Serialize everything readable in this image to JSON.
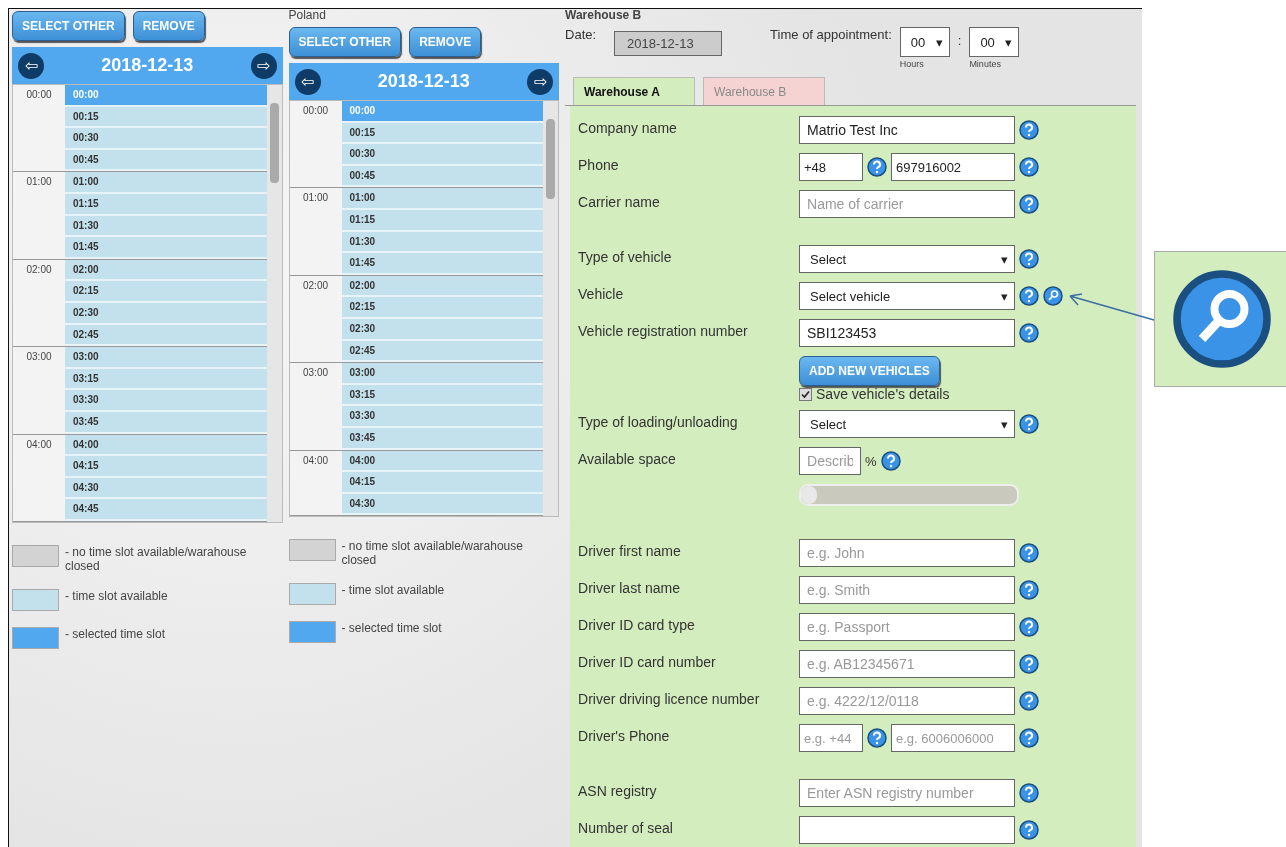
{
  "calendars": [
    {
      "buttons": [
        "SELECT OTHER",
        "REMOVE"
      ],
      "date": "2018-12-13",
      "prev": "⇦",
      "next": "⇨",
      "hours": [
        {
          "label": "00:00",
          "slots": [
            {
              "time": "00:00",
              "selected": true
            },
            {
              "time": "00:15",
              "selected": false
            },
            {
              "time": "00:30",
              "selected": false
            },
            {
              "time": "00:45",
              "selected": false
            }
          ]
        },
        {
          "label": "01:00",
          "slots": [
            {
              "time": "01:00",
              "selected": false
            },
            {
              "time": "01:15",
              "selected": false
            },
            {
              "time": "01:30",
              "selected": false
            },
            {
              "time": "01:45",
              "selected": false
            }
          ]
        },
        {
          "label": "02:00",
          "slots": [
            {
              "time": "02:00",
              "selected": false
            },
            {
              "time": "02:15",
              "selected": false
            },
            {
              "time": "02:30",
              "selected": false
            },
            {
              "time": "02:45",
              "selected": false
            }
          ]
        },
        {
          "label": "03:00",
          "slots": [
            {
              "time": "03:00",
              "selected": false
            },
            {
              "time": "03:15",
              "selected": false
            },
            {
              "time": "03:30",
              "selected": false
            },
            {
              "time": "03:45",
              "selected": false
            }
          ]
        },
        {
          "label": "04:00",
          "slots": [
            {
              "time": "04:00",
              "selected": false
            },
            {
              "time": "04:15",
              "selected": false
            },
            {
              "time": "04:30",
              "selected": false
            },
            {
              "time": "04:45",
              "selected": false
            }
          ]
        }
      ],
      "legend": [
        {
          "color": "#d3d3d3",
          "text": "- no time slot available/warahouse closed"
        },
        {
          "color": "#c3e1ec",
          "text": "- time slot available"
        },
        {
          "color": "#52a8ee",
          "text": "- selected time slot"
        }
      ]
    },
    {
      "caption": "Poland",
      "buttons": [
        "SELECT OTHER",
        "REMOVE"
      ],
      "date": "2018-12-13",
      "prev": "⇦",
      "next": "⇨",
      "hours": [
        {
          "label": "00:00",
          "slots": [
            {
              "time": "00:00",
              "selected": true
            },
            {
              "time": "00:15",
              "selected": false
            },
            {
              "time": "00:30",
              "selected": false
            },
            {
              "time": "00:45",
              "selected": false
            }
          ]
        },
        {
          "label": "01:00",
          "slots": [
            {
              "time": "01:00",
              "selected": false
            },
            {
              "time": "01:15",
              "selected": false
            },
            {
              "time": "01:30",
              "selected": false
            },
            {
              "time": "01:45",
              "selected": false
            }
          ]
        },
        {
          "label": "02:00",
          "slots": [
            {
              "time": "02:00",
              "selected": false
            },
            {
              "time": "02:15",
              "selected": false
            },
            {
              "time": "02:30",
              "selected": false
            },
            {
              "time": "02:45",
              "selected": false
            }
          ]
        },
        {
          "label": "03:00",
          "slots": [
            {
              "time": "03:00",
              "selected": false
            },
            {
              "time": "03:15",
              "selected": false
            },
            {
              "time": "03:30",
              "selected": false
            },
            {
              "time": "03:45",
              "selected": false
            }
          ]
        },
        {
          "label": "04:00",
          "slots": [
            {
              "time": "04:00",
              "selected": false
            },
            {
              "time": "04:15",
              "selected": false
            },
            {
              "time": "04:30",
              "selected": false
            }
          ]
        }
      ],
      "legend": [
        {
          "color": "#d3d3d3",
          "text": "- no time slot available/warahouse closed"
        },
        {
          "color": "#c3e1ec",
          "text": "- time slot available"
        },
        {
          "color": "#52a8ee",
          "text": "- selected time slot"
        }
      ]
    }
  ],
  "booking": {
    "caption": "Warehouse B",
    "date_label": "Date:",
    "date": "2018-12-13",
    "time_label": "Time of appointment:",
    "hours": {
      "value": "00",
      "caret": "▾",
      "caption": "Hours"
    },
    "separator": ":",
    "minutes": {
      "value": "00",
      "caret": "▾",
      "caption": "Minutes"
    },
    "tabs": [
      {
        "label": "Warehouse A",
        "selected": true
      },
      {
        "label": "Warehouse B",
        "selected": false
      }
    ],
    "rows": [
      {
        "kind": "input",
        "label": "Company name",
        "value": "Matrio Test Inc"
      },
      {
        "kind": "phone",
        "label": "Phone",
        "prefix": {
          "value": "+48"
        },
        "number": {
          "value": "697916002"
        }
      },
      {
        "kind": "input",
        "label": "Carrier name",
        "placeholder": "Name of carrier",
        "gap_after": true
      },
      {
        "kind": "select",
        "label": "Type of vehicle",
        "value": "Select",
        "caret": "▾"
      },
      {
        "kind": "select",
        "label": "Vehicle",
        "value": "Select vehicle",
        "caret": "▾",
        "search": true
      },
      {
        "kind": "input",
        "label": "Vehicle registration number",
        "value": "SBI123453"
      },
      {
        "kind": "button",
        "label": "ADD NEW VEHICLES"
      },
      {
        "kind": "checkbox",
        "label": "Save vehicle's details",
        "checked": true
      },
      {
        "kind": "select",
        "label": "Type of loading/unloading",
        "value": "Select",
        "caret": "▾"
      },
      {
        "kind": "percent",
        "label": "Available space",
        "placeholder": "Describ",
        "unit": "%"
      },
      {
        "kind": "slider",
        "level": 0.0,
        "gap_after": true
      },
      {
        "kind": "input",
        "label": "Driver first name",
        "placeholder": "e.g. John"
      },
      {
        "kind": "input",
        "label": "Driver last name",
        "placeholder": "e.g. Smith"
      },
      {
        "kind": "input",
        "label": "Driver ID card type",
        "placeholder": "e.g. Passport"
      },
      {
        "kind": "input",
        "label": "Driver ID card number",
        "placeholder": "e.g. AB12345671"
      },
      {
        "kind": "input",
        "label": "Driver driving licence number",
        "placeholder": "e.g. 4222/12/0118"
      },
      {
        "kind": "phone",
        "label": "Driver's Phone",
        "prefix": {
          "placeholder": "e.g. +44"
        },
        "number": {
          "placeholder": "e.g. 6006006000"
        },
        "gap_after": true
      },
      {
        "kind": "input",
        "label": "ASN registry",
        "placeholder": "Enter ASN registry number"
      },
      {
        "kind": "input",
        "label": "Number of seal"
      }
    ]
  }
}
